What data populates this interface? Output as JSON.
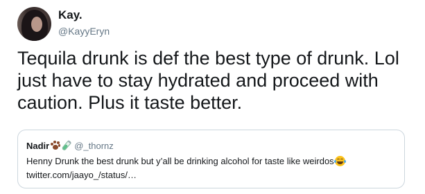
{
  "author": {
    "display_name": "Kay.",
    "handle": "@KayyEryn"
  },
  "tweet": {
    "text": "Tequila drunk is def the best type of drunk. Lol just have to stay hydrated and proceed with caution. Plus it taste better."
  },
  "quoted_tweet": {
    "display_name": "Nadir",
    "name_emojis": [
      "paw-prints-icon",
      "test-tube-icon"
    ],
    "handle": "@_thornz",
    "text": "Henny Drunk the best drunk but y’all be drinking alcohol for taste like weirdos",
    "text_emoji": "tears-of-joy-icon",
    "link": "twitter.com/jaayo_/status/…"
  }
}
